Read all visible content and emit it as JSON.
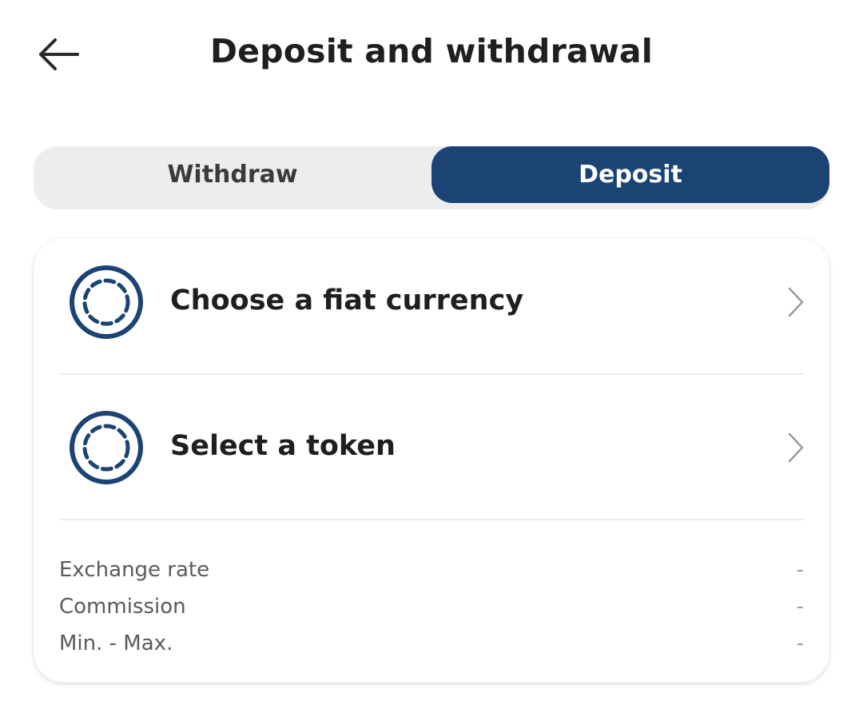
{
  "header": {
    "title": "Deposit and withdrawal",
    "back_icon": "arrow-left-icon"
  },
  "tabs": [
    {
      "label": "Withdraw",
      "selected": false
    },
    {
      "label": "Deposit",
      "selected": true
    }
  ],
  "card": {
    "rows": [
      {
        "label": "Choose a fiat currency",
        "icon": "coin-placeholder-icon"
      },
      {
        "label": "Select a token",
        "icon": "coin-placeholder-icon"
      }
    ],
    "info": [
      {
        "label": "Exchange rate",
        "value": "-"
      },
      {
        "label": "Commission",
        "value": "-"
      },
      {
        "label": "Min. - Max.",
        "value": "-"
      }
    ]
  },
  "colors": {
    "accent": "#1b4475",
    "segment_bg": "#eceeed"
  }
}
